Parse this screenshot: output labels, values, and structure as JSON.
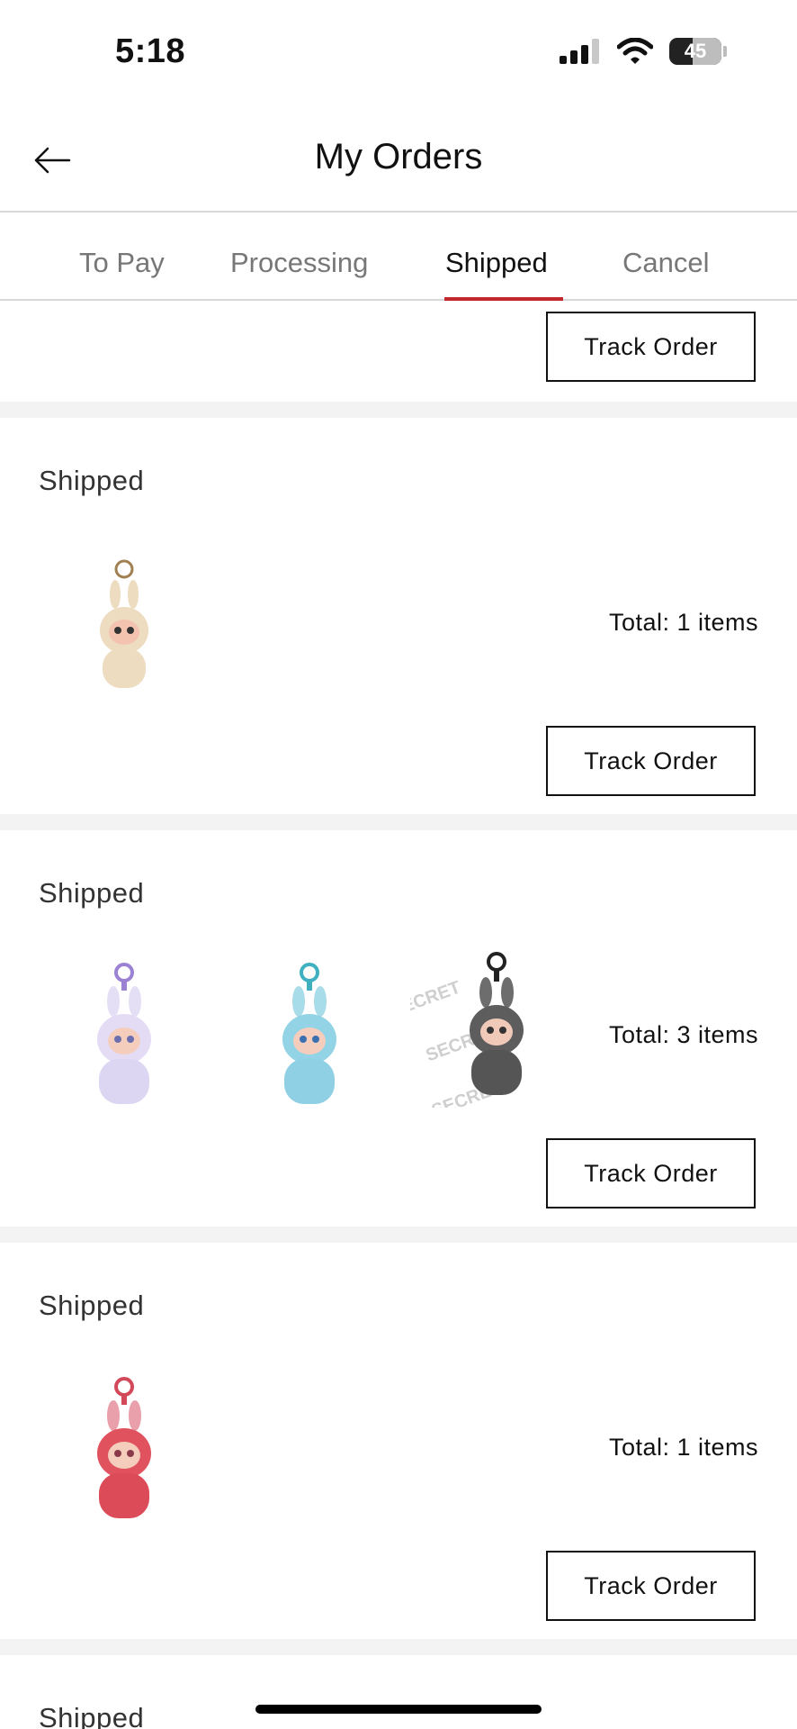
{
  "status_bar": {
    "time": "5:18",
    "battery": "45"
  },
  "header": {
    "title": "My Orders",
    "back_icon": "arrow-left-icon"
  },
  "tabs": [
    {
      "label": "To Pay",
      "active": false
    },
    {
      "label": "Processing",
      "active": false
    },
    {
      "label": "Shipped",
      "active": true
    },
    {
      "label": "Cancel",
      "active": false
    }
  ],
  "colors": {
    "accent": "#c2292e",
    "separator": "#f3f3f3"
  },
  "orders": [
    {
      "status": "",
      "total": "",
      "button": "Track Order",
      "items": []
    },
    {
      "status": "Shipped",
      "total": "Total: 1 items",
      "button": "Track Order",
      "items": [
        "beige-labubu-keychain"
      ]
    },
    {
      "status": "Shipped",
      "total": "Total: 3 items",
      "button": "Track Order",
      "items": [
        "lavender-labubu-keychain",
        "blue-labubu-keychain",
        "grey-secret-labubu-keychain"
      ]
    },
    {
      "status": "Shipped",
      "total": "Total: 1 items",
      "button": "Track Order",
      "items": [
        "red-labubu-keychain"
      ]
    },
    {
      "status": "Shipped",
      "total": "",
      "button": "",
      "items": []
    }
  ],
  "secret_watermark": "SECRET"
}
